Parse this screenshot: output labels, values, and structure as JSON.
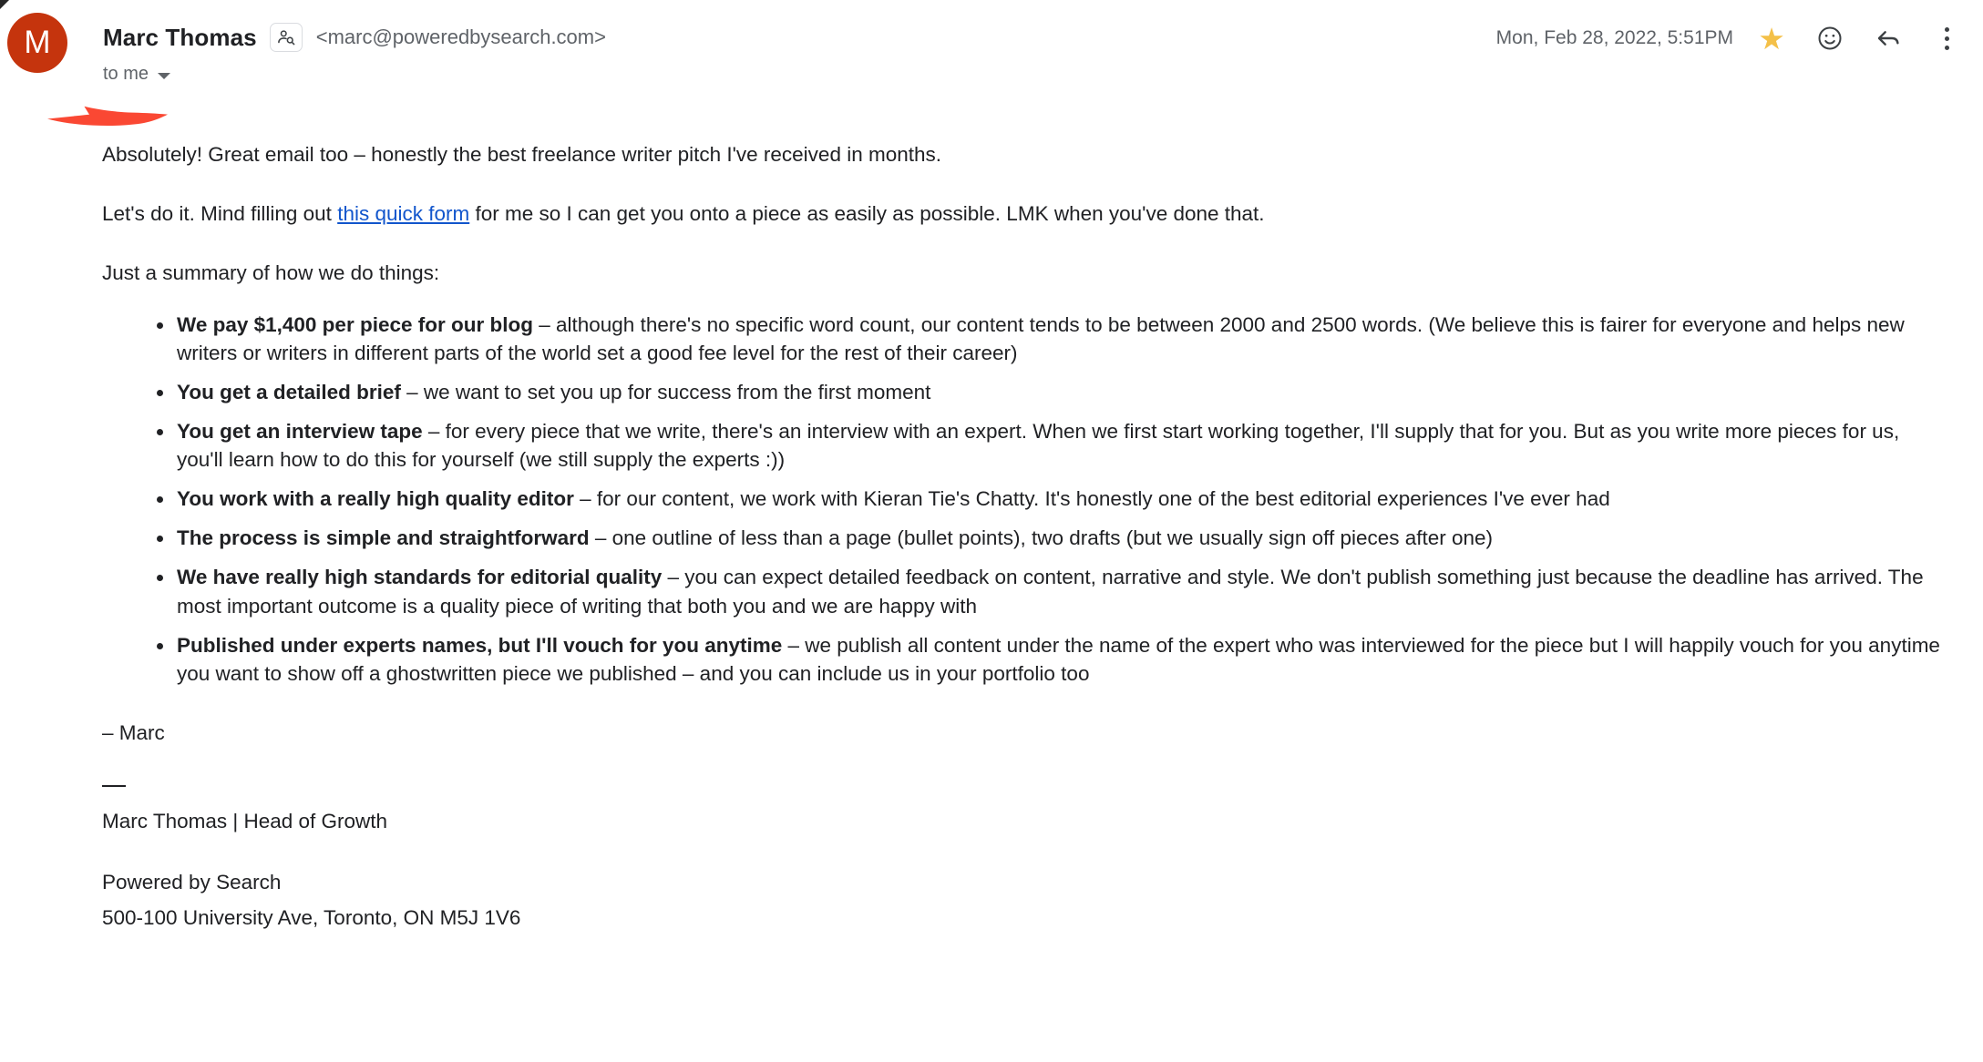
{
  "header": {
    "avatar_initial": "M",
    "avatar_color": "#c5340d",
    "sender_name": "Marc Thomas",
    "sender_email": "<marc@poweredbysearch.com>",
    "recipient": "to me",
    "timestamp": "Mon, Feb 28, 2022, 5:51PM",
    "contact_icon": "contact-search-icon",
    "star_glyph": "★",
    "star_color": "#f4c048",
    "emoji_icon": "add-reaction-icon",
    "reply_icon": "reply-icon",
    "more_icon": "more-options-icon"
  },
  "annotation": {
    "arrow_color": "#fa4833",
    "name": "red-arrow-annotation"
  },
  "body": {
    "paragraph_1": "Absolutely! Great email too – honestly the best freelance writer pitch I've received in months.",
    "paragraph_2_before": "Let's do it. Mind filling out ",
    "link_text": "this quick form",
    "paragraph_2_after": " for me so I can get you onto a piece as easily as possible. LMK when you've done that.",
    "paragraph_3": "Just a summary of how we do things:",
    "bullets": [
      {
        "bold": "We pay $1,400 per piece for our blog",
        "rest": " – although there's no specific word count, our content tends to be between 2000 and 2500 words. (We believe this is fairer for everyone and helps new writers or writers in different parts of the world set a good fee level for the rest of their career)"
      },
      {
        "bold": "You get a detailed brief",
        "rest": " – we want to set you up for success from the first moment"
      },
      {
        "bold": "You get an interview tape",
        "rest": " – for every piece that we write, there's an interview with an expert. When we first start working together, I'll supply that for you. But as you write more pieces for us, you'll learn how to do this for yourself (we still supply the experts :))"
      },
      {
        "bold": "You work with a really high quality editor",
        "rest": " – for our content, we work with Kieran Tie's Chatty. It's honestly one of the best editorial experiences I've ever had"
      },
      {
        "bold": "The process is simple and straightforward",
        "rest": " – one outline of less than a page (bullet points), two drafts (but we usually sign off pieces after one)"
      },
      {
        "bold": "We have really high standards for editorial quality",
        "rest": " – you can expect detailed feedback on content, narrative and style. We don't publish something just because the deadline has arrived. The most important outcome is a quality piece of writing that both you and we are happy with"
      },
      {
        "bold": "Published under experts names, but I'll vouch for you anytime",
        "rest": " – we publish all content under the name of the expert who was interviewed for the piece but I will happily vouch for you anytime you want to show off a ghostwritten piece we published – and you can include us in your portfolio too"
      }
    ],
    "sign_off": "– Marc",
    "signature_name": "Marc Thomas | Head of Growth",
    "signature_company": "Powered by Search",
    "signature_address": "500-100 University Ave, Toronto, ON M5J 1V6"
  }
}
